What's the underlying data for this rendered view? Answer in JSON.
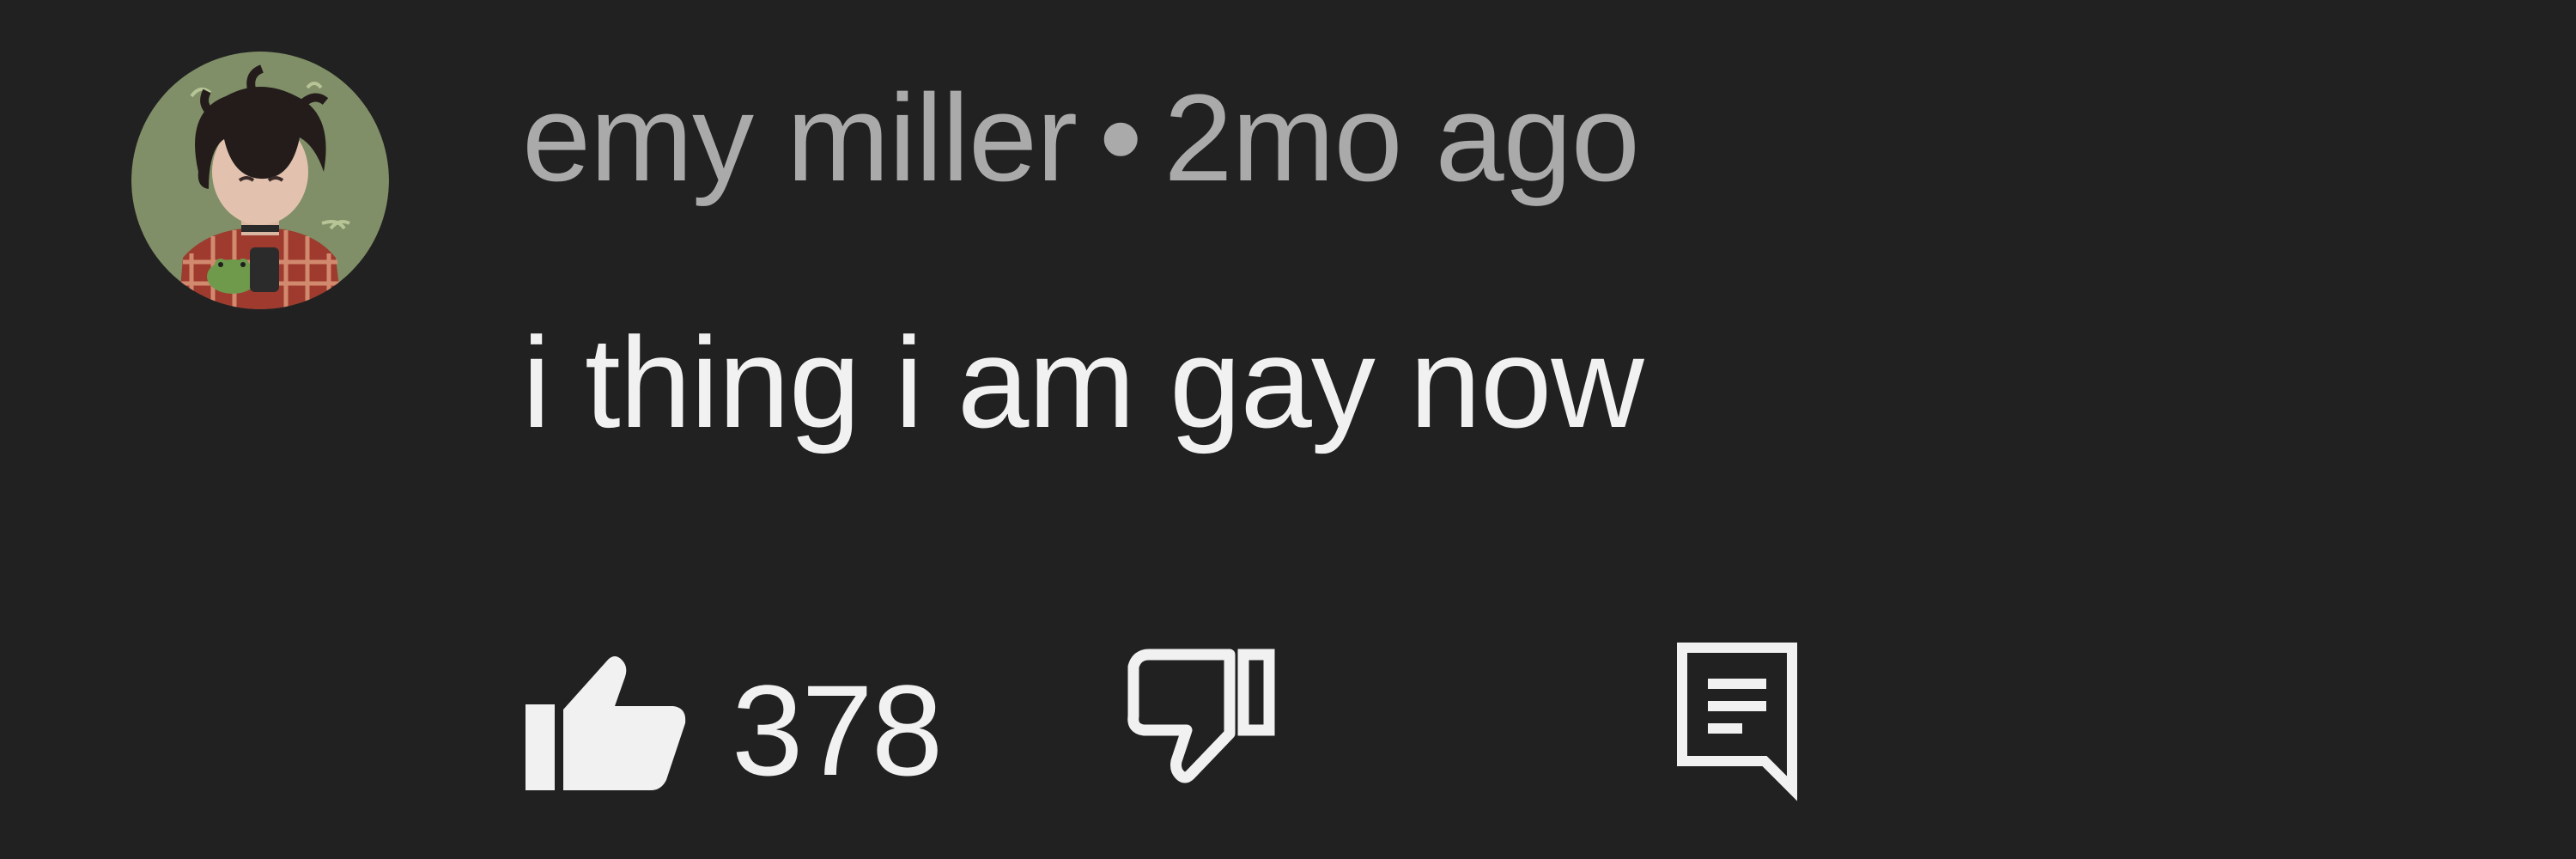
{
  "comment": {
    "author": "emy miller",
    "separator": "•",
    "timestamp": "2mo ago",
    "text": "i thing i am gay now",
    "like_count": "378"
  },
  "icons": {
    "like": "thumbs-up-icon",
    "dislike": "thumbs-down-icon",
    "reply": "reply-comment-icon"
  },
  "colors": {
    "background": "#212121",
    "meta_text": "#aaaaaa",
    "primary_text": "#f1f1f1"
  }
}
